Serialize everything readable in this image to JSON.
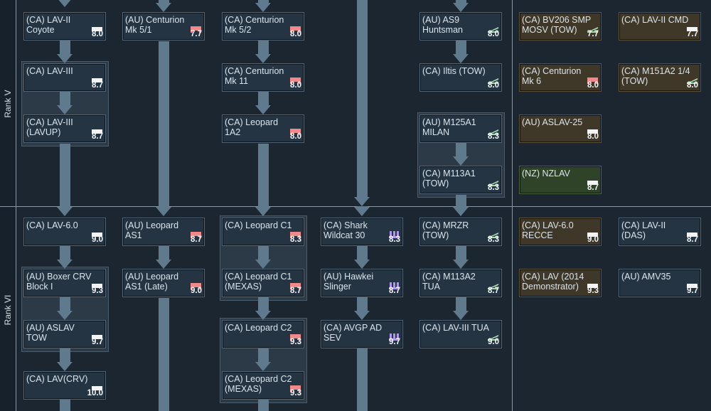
{
  "ranks": [
    {
      "label": "Rank V"
    },
    {
      "label": "Rank VI"
    }
  ],
  "colors": {
    "background": "#1b2631",
    "card": "#243442",
    "card_premium": "#3f3727",
    "card_squadron": "#2f4328",
    "arrow": "#5f7a8c",
    "flag_white": "#f4f4f4",
    "flag_red": "#f08a8a",
    "flag_green": "#a7dcae",
    "flag_purple": "#b196f0"
  },
  "icon_types": {
    "light": "white-flag-icon",
    "mbt": "red-flag-icon",
    "atgm": "green-ramp-icon",
    "spaa": "purple-spaa-icon"
  },
  "vehicles": [
    {
      "name": "(CA) LAV-II Coyote",
      "br": "8.0",
      "icon": "light",
      "style": "normal"
    },
    {
      "name": "(AU) Centurion Mk 5/1",
      "br": "7.7",
      "icon": "mbt",
      "style": "normal"
    },
    {
      "name": "(CA) Centurion Mk 5/2",
      "br": "8.0",
      "icon": "mbt",
      "style": "normal"
    },
    {
      "name": "(AU) AS9 Huntsman",
      "br": "8.0",
      "icon": "atgm",
      "style": "normal"
    },
    {
      "name": "(CA) BV206 SMP MOSV (TOW)",
      "br": "7.7",
      "icon": "atgm",
      "style": "premium"
    },
    {
      "name": "(CA) LAV-II CMD",
      "br": "7.7",
      "icon": "light",
      "style": "premium"
    },
    {
      "name": "(CA) LAV-III",
      "br": "8.7",
      "icon": "light",
      "style": "normal"
    },
    {
      "name": "(CA) Centurion Mk 11",
      "br": "8.0",
      "icon": "mbt",
      "style": "normal"
    },
    {
      "name": "(CA) Iltis (TOW)",
      "br": "8.0",
      "icon": "atgm",
      "style": "normal"
    },
    {
      "name": "(CA) Centurion Mk 6",
      "br": "8.0",
      "icon": "mbt",
      "style": "premium"
    },
    {
      "name": "(CA) M151A2 1/4 (TOW)",
      "br": "8.0",
      "icon": "atgm",
      "style": "premium"
    },
    {
      "name": "(CA) LAV-III (LAVUP)",
      "br": "8.7",
      "icon": "light",
      "style": "normal"
    },
    {
      "name": "(CA) Leopard 1A2",
      "br": "8.0",
      "icon": "mbt",
      "style": "normal"
    },
    {
      "name": "(AU) M125A1 MILAN",
      "br": "8.3",
      "icon": "atgm",
      "style": "normal"
    },
    {
      "name": "(AU) ASLAV-25",
      "br": "8.0",
      "icon": "light",
      "style": "premium"
    },
    {
      "name": "(CA) M113A1 (TOW)",
      "br": "8.3",
      "icon": "atgm",
      "style": "normal"
    },
    {
      "name": "(NZ) NZLAV",
      "br": "8.7",
      "icon": "light",
      "style": "squadron"
    },
    {
      "name": "(CA) LAV-6.0",
      "br": "9.0",
      "icon": "light",
      "style": "normal"
    },
    {
      "name": "(AU) Leopard AS1",
      "br": "8.7",
      "icon": "mbt",
      "style": "normal"
    },
    {
      "name": "(CA) Leopard C1",
      "br": "8.3",
      "icon": "mbt",
      "style": "normal"
    },
    {
      "name": "(CA) Shark Wildcat 30",
      "br": "8.3",
      "icon": "spaa",
      "style": "normal"
    },
    {
      "name": "(CA) MRZR (TOW)",
      "br": "8.3",
      "icon": "atgm",
      "style": "normal"
    },
    {
      "name": "(CA) LAV-6.0 RECCE",
      "br": "9.0",
      "icon": "light",
      "style": "premium"
    },
    {
      "name": "(CA) LAV-II (DAS)",
      "br": "8.7",
      "icon": "light",
      "style": "normal"
    },
    {
      "name": "(AU) Boxer CRV Block I",
      "br": "9.3",
      "icon": "light",
      "style": "normal"
    },
    {
      "name": "(AU) Leopard AS1 (Late)",
      "br": "9.0",
      "icon": "mbt",
      "style": "normal"
    },
    {
      "name": "(CA) Leopard C1 (MEXAS)",
      "br": "8.7",
      "icon": "mbt",
      "style": "normal"
    },
    {
      "name": "(AU) Hawkei Slinger",
      "br": "8.7",
      "icon": "spaa",
      "style": "normal"
    },
    {
      "name": "(CA) M113A2 TUA",
      "br": "8.7",
      "icon": "atgm",
      "style": "normal"
    },
    {
      "name": "(CA) LAV (2014 Demonstrator)",
      "br": "9.3",
      "icon": "light",
      "style": "premium"
    },
    {
      "name": "(AU) AMV35",
      "br": "9.7",
      "icon": "light",
      "style": "normal"
    },
    {
      "name": "(AU) ASLAV TOW",
      "br": "9.7",
      "icon": "light",
      "style": "normal"
    },
    {
      "name": "(CA) Leopard C2",
      "br": "9.3",
      "icon": "mbt",
      "style": "normal"
    },
    {
      "name": "(CA) AVGP AD SEV",
      "br": "9.7",
      "icon": "spaa",
      "style": "normal"
    },
    {
      "name": "(CA) LAV-III TUA",
      "br": "9.0",
      "icon": "atgm",
      "style": "normal"
    },
    {
      "name": "(CA) LAV(CRV)",
      "br": "10.0",
      "icon": "light",
      "style": "normal"
    },
    {
      "name": "(CA) Leopard C2 (MEXAS)",
      "br": "9.3",
      "icon": "mbt",
      "style": "normal"
    }
  ]
}
